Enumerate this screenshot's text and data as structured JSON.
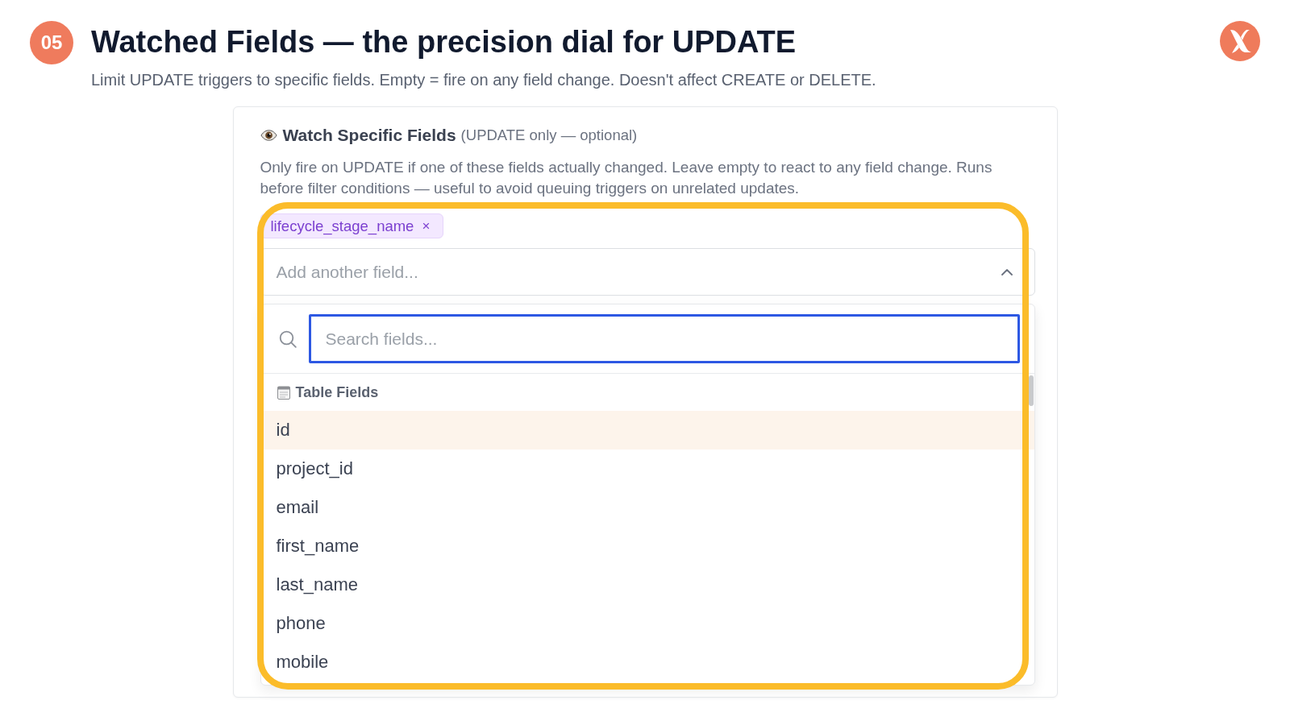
{
  "slide": {
    "number": "05",
    "title": "Watched Fields — the precision dial for UPDATE",
    "subtitle": "Limit UPDATE triggers to specific fields. Empty = fire on any field change. Doesn't affect CREATE or DELETE."
  },
  "panel": {
    "title": "Watch Specific Fields",
    "title_note": "(UPDATE only — optional)",
    "description": "Only fire on UPDATE if one of these fields actually changed. Leave empty to react to any field change. Runs before filter conditions — useful to avoid queuing triggers on unrelated updates.",
    "tags": [
      {
        "label": "lifecycle_stage_name",
        "remove": "×"
      }
    ],
    "select": {
      "placeholder": "Add another field...",
      "expanded": true
    },
    "dropdown": {
      "search": {
        "placeholder": "Search fields...",
        "focused": true
      },
      "section": "Table Fields",
      "options": [
        {
          "label": "id",
          "selected": true
        },
        {
          "label": "project_id",
          "selected": false
        },
        {
          "label": "email",
          "selected": false
        },
        {
          "label": "first_name",
          "selected": false
        },
        {
          "label": "last_name",
          "selected": false
        },
        {
          "label": "phone",
          "selected": false
        },
        {
          "label": "mobile",
          "selected": false
        }
      ]
    }
  }
}
